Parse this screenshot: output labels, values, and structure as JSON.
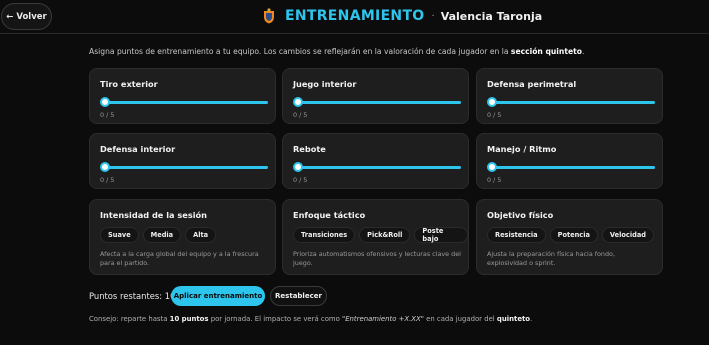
{
  "header": {
    "back_label": "← Volver",
    "title": "ENTRENAMIENTO",
    "separator": "·",
    "team": "Valencia Taronja"
  },
  "intro": {
    "text": "Asigna puntos de entrenamiento a tu equipo. Los cambios se reflejarán en la valoración de cada jugador en la ",
    "bold": "sección quinteto",
    "end": "."
  },
  "sliders": [
    {
      "label": "Tiro exterior",
      "value": "0 / 5",
      "level": 0
    },
    {
      "label": "Juego interior",
      "value": "0 / 5",
      "level": 0
    },
    {
      "label": "Defensa perimetral",
      "value": "0 / 5",
      "level": 0
    },
    {
      "label": "Defensa interior",
      "value": "0 / 5",
      "level": 0
    },
    {
      "label": "Rebote",
      "value": "0 / 5",
      "level": 0
    },
    {
      "label": "Manejo / Ritmo",
      "value": "0 / 5",
      "level": 0
    }
  ],
  "options": [
    {
      "label": "Intensidad de la sesión",
      "chips": [
        "Suave",
        "Media",
        "Alta"
      ],
      "description": "Afecta a la carga global del equipo y a la frescura para el partido."
    },
    {
      "label": "Enfoque táctico",
      "chips": [
        "Transiciones",
        "Pick&Roll",
        "Poste bajo"
      ],
      "description": "Prioriza automatismos ofensivos y lecturas clave del juego."
    },
    {
      "label": "Objetivo físico",
      "chips": [
        "Resistencia",
        "Potencia",
        "Velocidad"
      ],
      "description": "Ajusta la preparación física hacia fondo, explosividad o sprint."
    }
  ],
  "footer": {
    "remaining": "Puntos restantes: 10",
    "apply_label": "Aplicar entrenamiento",
    "reset_label": "Restablecer",
    "tip_start": "Consejo: reparte hasta ",
    "tip_bold1": "10 puntos",
    "tip_mid": " por jornada. El impacto se verá como ",
    "tip_italic": "\"Entrenamiento +X.XX\"",
    "tip_mid2": " en cada jugador del ",
    "tip_bold2": "quinteto",
    "tip_end": "."
  },
  "colors": {
    "accent": "#2ec5ec",
    "background": "#0c0c0c",
    "card": "#1e1e1e"
  }
}
